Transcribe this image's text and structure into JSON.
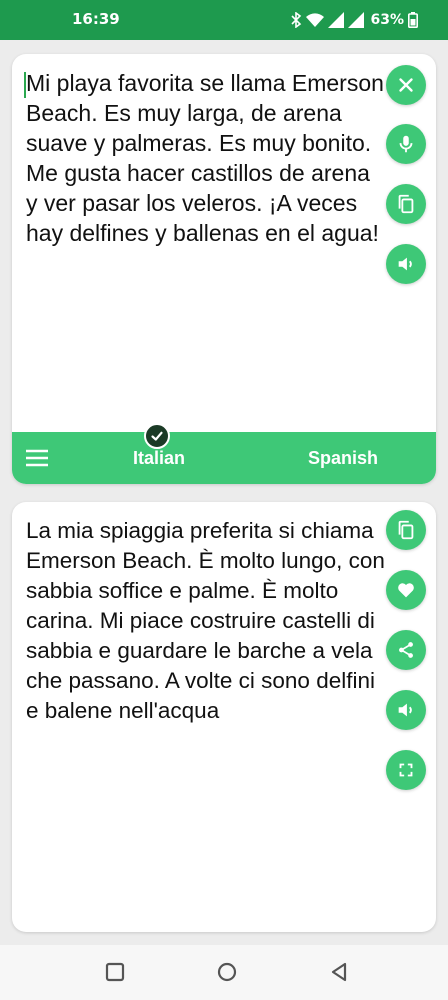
{
  "status_bar": {
    "time": "16:39",
    "battery": "63%",
    "icons": [
      "bluetooth-icon",
      "wifi-icon",
      "signal-icon",
      "signal-icon",
      "battery-icon"
    ]
  },
  "source_panel": {
    "text": "Mi playa favorita se llama Emerson Beach. Es muy larga, de arena suave y palmeras. Es muy bonito. Me gusta hacer castillos de arena y ver pasar los veleros. ¡A veces hay delfines y ballenas en el agua!",
    "actions": [
      "clear-icon",
      "microphone-icon",
      "copy-icon",
      "speaker-icon"
    ]
  },
  "language_bar": {
    "source_language": "Italian",
    "target_language": "Spanish",
    "selected": "Italian"
  },
  "target_panel": {
    "text": "La mia spiaggia preferita si chiama Emerson Beach. È molto lungo, con sabbia soffice e palme. È molto carina. Mi piace costruire castelli di sabbia e guardare le barche a vela che passano. A volte ci sono delfini e balene nell'acqua",
    "actions": [
      "copy-icon",
      "heart-icon",
      "share-icon",
      "speaker-icon",
      "fullscreen-icon"
    ]
  },
  "colors": {
    "status_bar": "#1e9a4e",
    "accent": "#3ec877",
    "background": "#ececec"
  }
}
